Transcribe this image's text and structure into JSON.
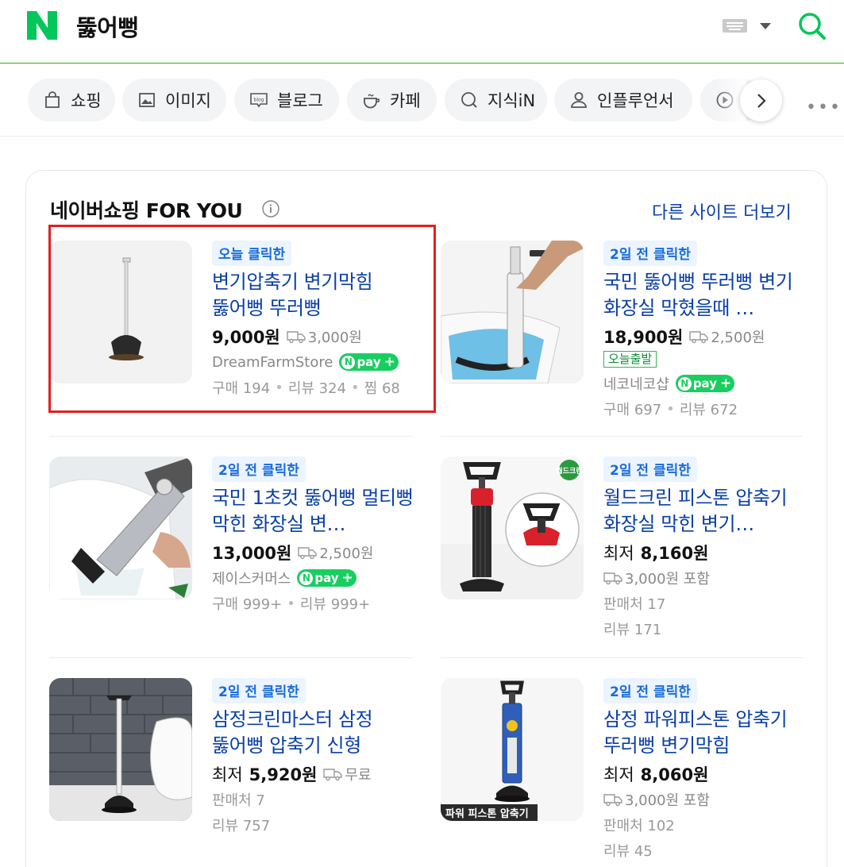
{
  "header": {
    "query": "뚫어뻥",
    "logo_icon": "naver-n-logo",
    "keyboard_icon": "keyboard-icon",
    "search_icon": "search-icon",
    "brand_color": "#2db400"
  },
  "tabs": [
    {
      "label": "쇼핑",
      "icon": "shopping-bag-icon"
    },
    {
      "label": "이미지",
      "icon": "image-icon"
    },
    {
      "label": "블로그",
      "icon": "blog-icon"
    },
    {
      "label": "카페",
      "icon": "cafe-cup-icon"
    },
    {
      "label": "지식iN",
      "icon": "knowledge-search-icon"
    },
    {
      "label": "인플루언서",
      "icon": "person-icon"
    },
    {
      "label": "",
      "icon": "video-play-icon"
    }
  ],
  "section": {
    "title": "네이버쇼핑 FOR YOU",
    "more_link": "다른 사이트 더보기"
  },
  "products": [
    {
      "badge": "오늘 클릭한",
      "title": "변기압축기 변기막힘 뚫어뻥 뚜러뻥",
      "price": "9,000원",
      "shipping": "3,000원",
      "seller": "DreamFarmStore",
      "npay": "pay",
      "stats": [
        "구매 194",
        "리뷰 324",
        "찜 68"
      ],
      "highlighted": true
    },
    {
      "badge": "2일 전 클릭한",
      "title": "국민 뚫어뻥 뚜러뻥 변기 화장실 막혔을때 …",
      "price": "18,900원",
      "shipping": "2,500원",
      "tag": "오늘출발",
      "seller": "네코네코샵",
      "npay": "pay",
      "stats": [
        "구매 697",
        "리뷰 672"
      ]
    },
    {
      "badge": "2일 전 클릭한",
      "title": "국민 1초컷 뚫어뻥 멀티뻥 막힌 화장실 변…",
      "price": "13,000원",
      "shipping": "2,500원",
      "seller": "제이스커머스",
      "npay": "pay",
      "stats": [
        "구매 999+",
        "리뷰 999+"
      ]
    },
    {
      "badge": "2일 전 클릭한",
      "title": "월드크린 피스톤 압축기 화장실 막힌 변기…",
      "price_prefix": "최저",
      "price": "8,160원",
      "shipping": "3,000원 포함",
      "sellers": "판매처 17",
      "reviews": "리뷰 171",
      "thumb_logo": "월드크린"
    },
    {
      "badge": "2일 전 클릭한",
      "title": "삼정크린마스터 삼정 뚫어뻥 압축기 신형",
      "price_prefix": "최저",
      "price": "5,920원",
      "shipping": "무료",
      "sellers": "판매처 7",
      "reviews": "리뷰 757"
    },
    {
      "badge": "2일 전 클릭한",
      "title": "삼정 파워피스톤 압축기 뚜러뻥 변기막힘",
      "price_prefix": "최저",
      "price": "8,060원",
      "shipping": "3,000원 포함",
      "sellers": "판매처 102",
      "reviews": "리뷰 45",
      "thumb_caption": "파워 피스톤 압축기"
    }
  ]
}
